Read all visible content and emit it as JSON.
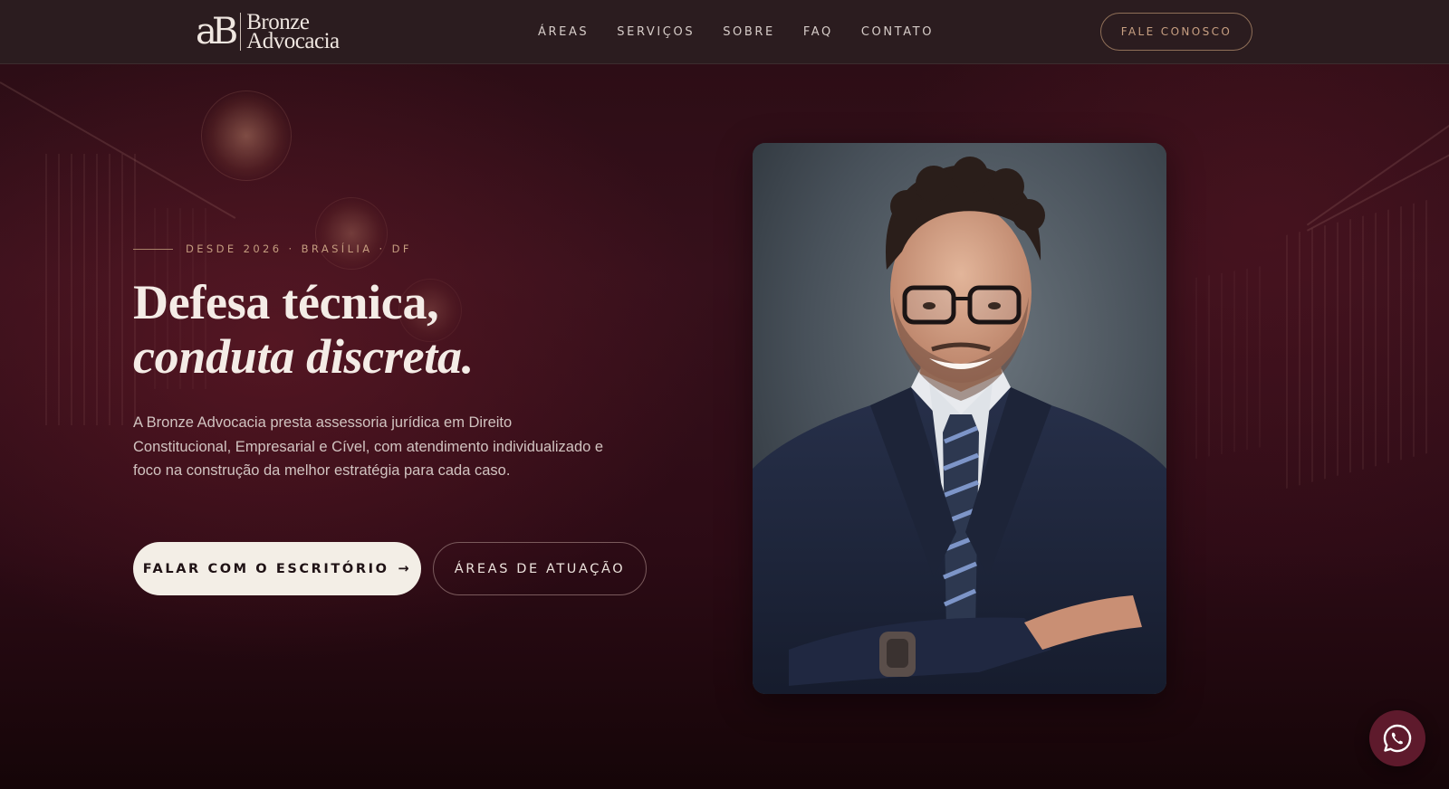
{
  "brand": {
    "logo_monogram": "aB",
    "name_line1": "Bronze",
    "name_line2": "Advocacia"
  },
  "nav": {
    "items": [
      "ÁREAS",
      "SERVIÇOS",
      "SOBRE",
      "FAQ",
      "CONTATO"
    ]
  },
  "header": {
    "cta_label": "FALE CONOSCO"
  },
  "hero": {
    "eyebrow": "DESDE 2026 · BRASÍLIA · DF",
    "headline_line1": "Defesa técnica,",
    "headline_line2": "conduta discreta.",
    "lead": "A Bronze Advocacia presta assessoria jurídica em Direito Constitucional, Empresarial e Cível, com atendimento individualizado e foco na construção da melhor estratégia para cada caso.",
    "primary_button": "FALAR COM O ESCRITÓRIO",
    "primary_button_arrow": "→",
    "secondary_button": "ÁREAS DE ATUAÇÃO"
  },
  "icons": {
    "floating_chat": "whatsapp-icon",
    "portrait": "lawyer-portrait-photo"
  },
  "colors": {
    "accent_bronze": "#c79f82",
    "background_wine": "#2a0c14",
    "header_bg": "#2b1c1f",
    "primary_button_bg": "#f3eee6",
    "whatsapp_bg": "#5e1a2c"
  }
}
